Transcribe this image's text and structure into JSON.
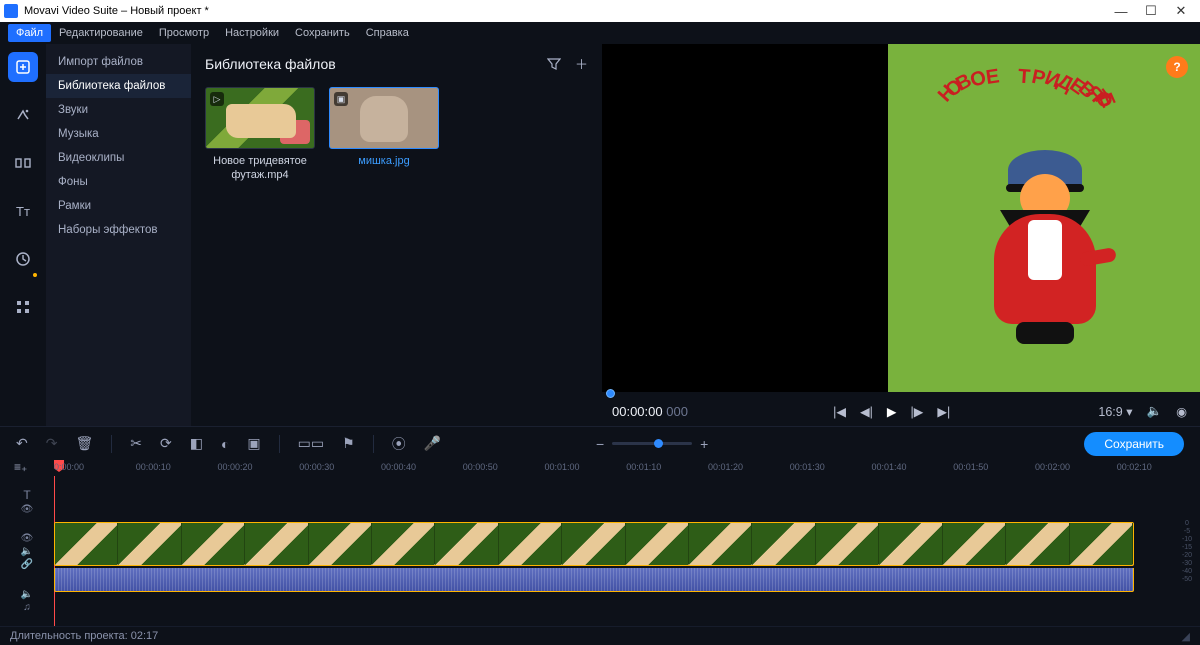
{
  "window": {
    "title": "Movavi Video Suite – Новый проект *"
  },
  "menu": {
    "file": "Файл",
    "edit": "Редактирование",
    "view": "Просмотр",
    "settings": "Настройки",
    "save": "Сохранить",
    "help": "Справка"
  },
  "categories": {
    "import": "Импорт файлов",
    "library": "Библиотека файлов",
    "sounds": "Звуки",
    "music": "Музыка",
    "videoclips": "Видеоклипы",
    "backgrounds": "Фоны",
    "frames": "Рамки",
    "effectsets": "Наборы эффектов"
  },
  "library": {
    "title": "Библиотека файлов",
    "items": [
      {
        "caption": "Новое тридевятое футаж.mp4",
        "badge": "▷",
        "selected": false,
        "kind": "video"
      },
      {
        "caption": "мишка.jpg",
        "badge": "▣",
        "selected": true,
        "kind": "image"
      }
    ]
  },
  "preview": {
    "arc_text": "НОВОЕ ТРИДЕВЯТОЕ",
    "timecode": "00:00:00",
    "timecode_ms": "000",
    "aspect": "16:9",
    "help": "?"
  },
  "toolbar": {
    "save": "Сохранить",
    "zoom_minus": "−",
    "zoom_plus": "+"
  },
  "ruler": {
    "ticks": [
      "0:00:00",
      "00:00:10",
      "00:00:20",
      "00:00:30",
      "00:00:40",
      "00:00:50",
      "00:01:00",
      "00:01:10",
      "00:01:20",
      "00:01:30",
      "00:01:40",
      "00:01:50",
      "00:02:00",
      "00:02:10"
    ]
  },
  "status": {
    "duration_label": "Длительность проекта: 02:17"
  },
  "icons": {
    "plus": "＋",
    "filter": "⍉"
  }
}
